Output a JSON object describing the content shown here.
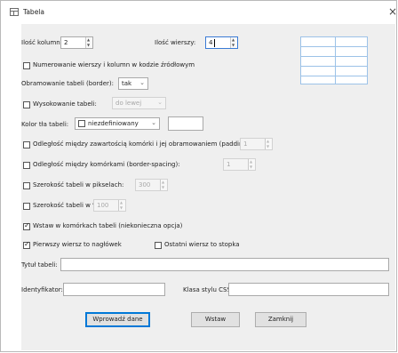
{
  "window": {
    "title": "Tabela",
    "close": "×"
  },
  "rows_cols": {
    "columns_label": "Ilość kolumn:",
    "columns_value": "2",
    "rows_label": "Ilość wierszy:",
    "rows_value": "4"
  },
  "options": {
    "numbering_label": "Numerowanie wierszy i kolumn w kodzie źródłowym",
    "border_label": "Obramowanie tabeli (border):",
    "border_value": "tak",
    "height_label": "Wysokowanie tabeli:",
    "height_value": "do lewej",
    "bgcolor_label": "Kolor tła tabeli:",
    "bgcolor_value": "niezdefiniowany",
    "padding_label": "Odległość między zawartością komórki i jej obramowaniem (padding):",
    "padding_value": "1",
    "spacing_label": "Odległość między komórkami (border-spacing):",
    "spacing_value": "1",
    "width_px_label": "Szerokość tabeli w pikselach:",
    "width_px_value": "300",
    "width_pct_label": "Szerokość tabeli w %:",
    "width_pct_value": "100",
    "nbsp_label": "Wstaw w komórkach tabeli  (niekonieczna opcja)",
    "first_row_label": "Pierwszy wiersz to nagłówek",
    "last_row_label": "Ostatni wiersz to stopka"
  },
  "fields": {
    "caption_label": "Tytuł tabeli:",
    "caption_value": "",
    "id_label": "Identyfikator:",
    "id_value": "",
    "css_label": "Klasa stylu CSS:",
    "css_value": ""
  },
  "buttons": {
    "insert": "Wprowadź dane",
    "paste": "Wstaw",
    "close": "Zamknij"
  }
}
